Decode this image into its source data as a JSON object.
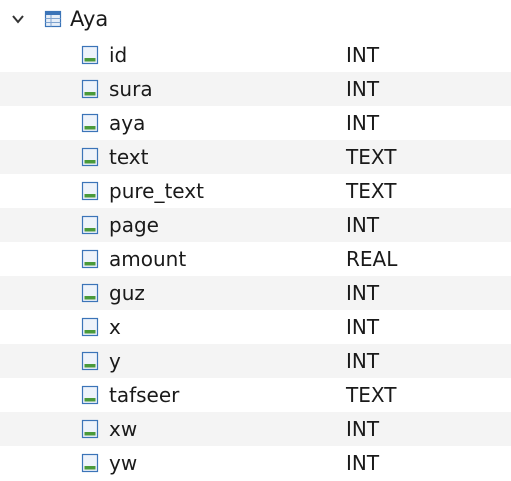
{
  "table": {
    "name": "Aya",
    "expand_icon": "chevron-down-icon",
    "table_icon": "table-icon"
  },
  "columns": [
    {
      "name": "id",
      "type": "INT"
    },
    {
      "name": "sura",
      "type": "INT"
    },
    {
      "name": "aya",
      "type": "INT"
    },
    {
      "name": "text",
      "type": "TEXT"
    },
    {
      "name": "pure_text",
      "type": "TEXT"
    },
    {
      "name": "page",
      "type": "INT"
    },
    {
      "name": "amount",
      "type": "REAL"
    },
    {
      "name": "guz",
      "type": "INT"
    },
    {
      "name": "x",
      "type": "INT"
    },
    {
      "name": "y",
      "type": "INT"
    },
    {
      "name": "tafseer",
      "type": "TEXT"
    },
    {
      "name": "xw",
      "type": "INT"
    },
    {
      "name": "yw",
      "type": "INT"
    }
  ],
  "colors": {
    "row_alt": "#f4f4f4",
    "icon_border": "#3b74b8",
    "icon_fill": "#dfe9f6",
    "icon_accent": "#4a9a3a"
  }
}
